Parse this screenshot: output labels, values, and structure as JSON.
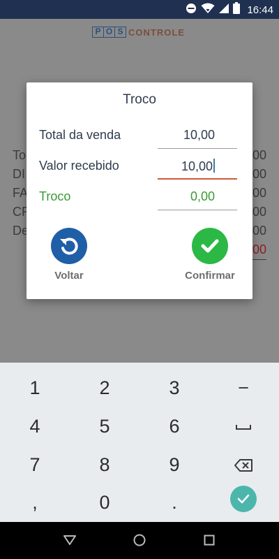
{
  "status_bar": {
    "time": "16:44"
  },
  "app": {
    "logo_letters": [
      "P",
      "O",
      "S"
    ],
    "logo_text": "CONTROLE",
    "bg_labels": [
      "To",
      "DI",
      "FA",
      "CR",
      "De"
    ],
    "bg_values": [
      "00",
      "00",
      "00",
      "00",
      "00"
    ],
    "bg_negative": "00"
  },
  "dialog": {
    "title": "Troco",
    "rows": [
      {
        "label": "Total da venda",
        "value": "10,00"
      },
      {
        "label": "Valor recebido",
        "value": "10,00"
      },
      {
        "label": "Troco",
        "value": "0,00"
      }
    ],
    "back_label": "Voltar",
    "confirm_label": "Confirmar"
  },
  "keyboard": {
    "keys": [
      "1",
      "2",
      "3",
      "−",
      "4",
      "5",
      "6",
      "␣",
      "7",
      "8",
      "9",
      "⌫",
      ",",
      "0",
      ".",
      "✓"
    ]
  },
  "colors": {
    "status_bar": "#1f3050",
    "accent_blue": "#1f5fa8",
    "accent_green": "#2bb845",
    "active_underline": "#d0583c",
    "done_key": "#4db6ac"
  }
}
